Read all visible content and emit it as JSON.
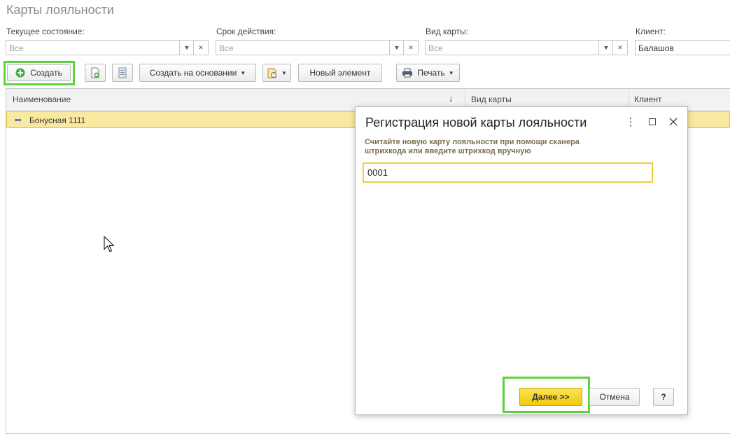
{
  "page": {
    "title": "Карты лояльности"
  },
  "filters": {
    "state": {
      "label": "Текущее состояние:",
      "value": "Все"
    },
    "period": {
      "label": "Срок действия:",
      "value": "Все"
    },
    "card_type": {
      "label": "Вид карты:",
      "value": "Все"
    },
    "client": {
      "label": "Клиент:",
      "value": "Балашов"
    }
  },
  "toolbar": {
    "create": "Создать",
    "create_based_on": "Создать на основании",
    "new_element": "Новый элемент",
    "print": "Печать"
  },
  "table": {
    "columns": [
      "Наименование",
      "Вид карты",
      "Клиент"
    ],
    "sort_indicator": "↓",
    "rows": [
      {
        "name": "Бонусная 1111",
        "card_type": "",
        "client": ""
      }
    ]
  },
  "dialog": {
    "title": "Регистрация новой карты лояльности",
    "hint": "Считайте новую карту лояльности при помощи сканера штрихкода или введите штрихкод вручную",
    "barcode_value": "0001",
    "next_button": "Далее >>",
    "cancel_button": "Отмена",
    "help_button": "?"
  },
  "colors": {
    "highlight_green": "#5dd33a",
    "selected_row": "#f9e9a0",
    "primary_button": "#f5d21e"
  }
}
